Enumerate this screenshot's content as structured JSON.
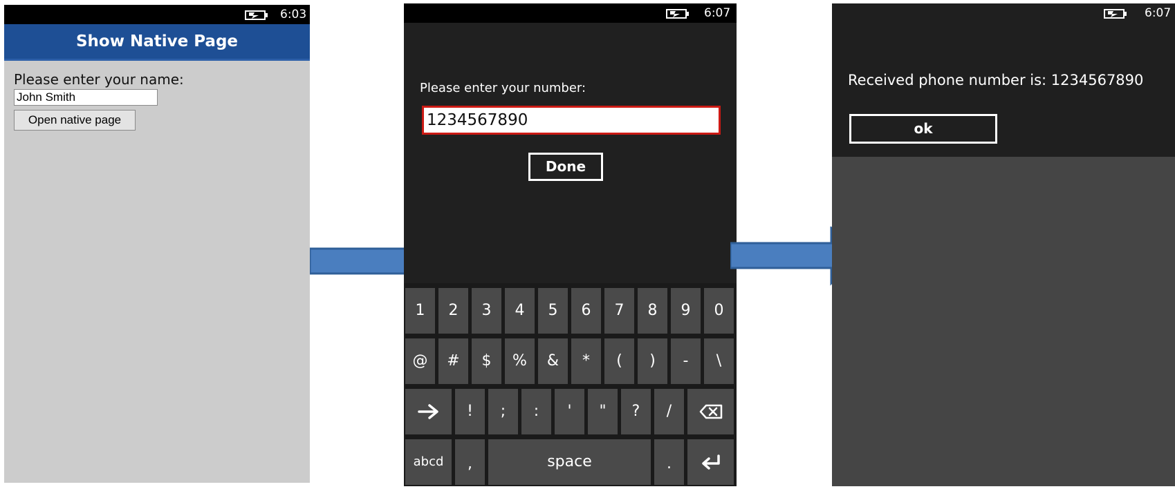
{
  "screen1": {
    "status_time": "6:03",
    "title": "Show Native Page",
    "prompt_label": "Please enter your name:",
    "name_value": "John Smith",
    "open_button_label": "Open native page"
  },
  "screen2": {
    "status_time": "6:07",
    "prompt_label": "Please enter your number:",
    "number_value": "1234567890",
    "done_button_label": "Done",
    "keyboard": {
      "row1": [
        "1",
        "2",
        "3",
        "4",
        "5",
        "6",
        "7",
        "8",
        "9",
        "0"
      ],
      "row2": [
        "@",
        "#",
        "$",
        "%",
        "&",
        "*",
        "(",
        ")",
        "-",
        "\\"
      ],
      "row3": [
        "!",
        ";",
        ":",
        "'",
        "\"",
        "?",
        "/"
      ],
      "row4": {
        "abc": "abcd",
        "comma": ",",
        "space": "space",
        "period": "."
      }
    }
  },
  "screen3": {
    "status_time": "6:07",
    "received_text": "Received phone number is: 1234567890",
    "ok_button_label": "ok"
  },
  "colors": {
    "header_blue": "#1e4f95",
    "arrow_blue": "#4a7ebf",
    "input_border_red": "#cc1a14"
  }
}
